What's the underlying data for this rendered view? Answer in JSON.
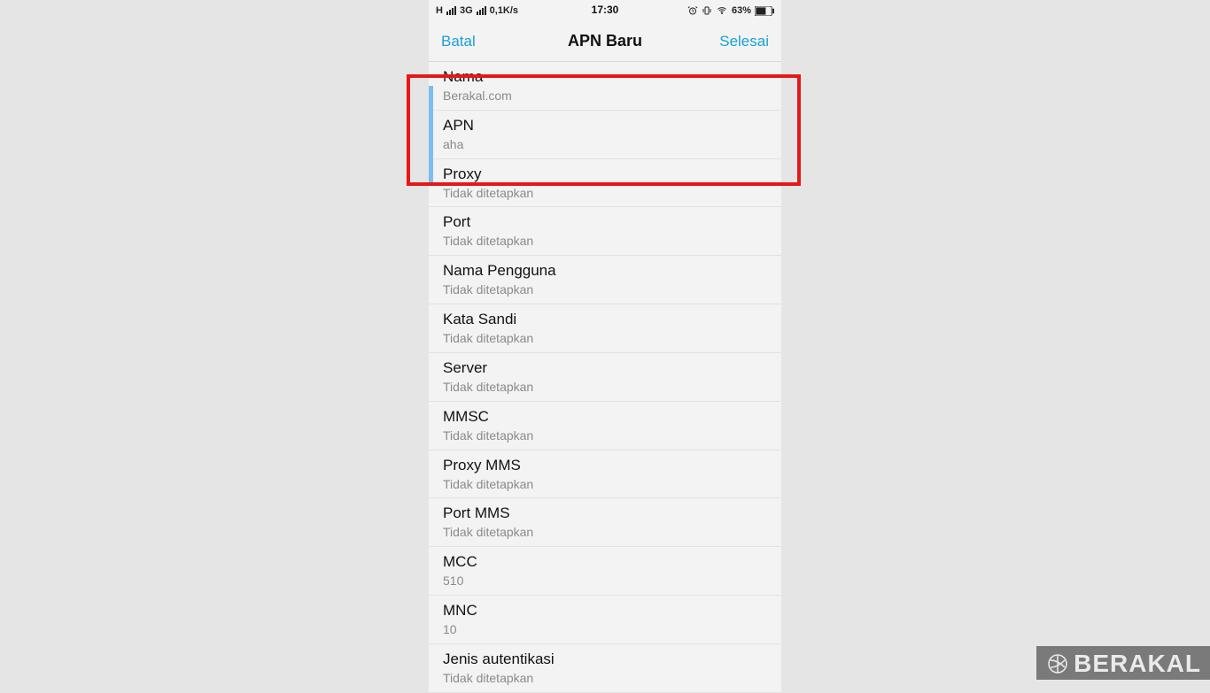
{
  "statusbar": {
    "left_text": "3G",
    "speed": "0,1K/s",
    "time": "17:30",
    "battery_text": "63%",
    "hsp": "H"
  },
  "navbar": {
    "left": "Batal",
    "title": "APN Baru",
    "right": "Selesai"
  },
  "rows": [
    {
      "label": "Nama",
      "value": "Berakal.com"
    },
    {
      "label": "APN",
      "value": "aha"
    },
    {
      "label": "Proxy",
      "value": "Tidak ditetapkan"
    },
    {
      "label": "Port",
      "value": "Tidak ditetapkan"
    },
    {
      "label": "Nama Pengguna",
      "value": "Tidak ditetapkan"
    },
    {
      "label": "Kata Sandi",
      "value": "Tidak ditetapkan"
    },
    {
      "label": "Server",
      "value": "Tidak ditetapkan"
    },
    {
      "label": "MMSC",
      "value": "Tidak ditetapkan"
    },
    {
      "label": "Proxy MMS",
      "value": "Tidak ditetapkan"
    },
    {
      "label": "Port MMS",
      "value": "Tidak ditetapkan"
    },
    {
      "label": "MCC",
      "value": "510"
    },
    {
      "label": "MNC",
      "value": "10"
    },
    {
      "label": "Jenis autentikasi",
      "value": "Tidak ditetapkan"
    }
  ],
  "watermark": {
    "text": "BERAKAL"
  }
}
